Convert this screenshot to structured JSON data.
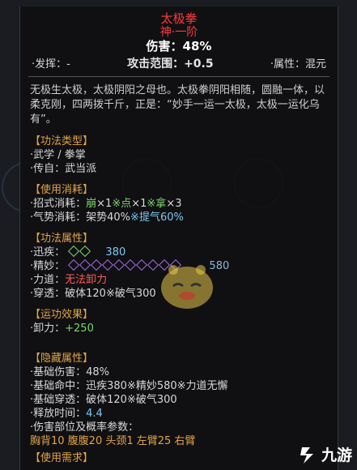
{
  "tooltip": {
    "name": "太极拳",
    "grade": "神·一阶",
    "damage": "伤害：48%",
    "windup": {
      "label": "·发挥：",
      "value": "-"
    },
    "range": {
      "label": "攻击范围：",
      "value": "+0.5"
    },
    "attribute": {
      "label": "·属性：",
      "value": "混元"
    },
    "description": "无极生太极，太极阴阳之母也。太极拳阴阳相随，圆融一体，以柔克刚，四两拨千斤，正是：“妙手一运一太极，太极一运化乌有”。"
  },
  "sections": {
    "type": {
      "header": "【功法类型】",
      "line1_label": "·武学 / 拳掌",
      "line2_label": "·传自：",
      "line2_value": "武当派"
    },
    "cost": {
      "header": "【使用消耗】",
      "moves_label": "·招式消耗：",
      "m1": "崩",
      "m1x": "×1",
      "m2": "※点",
      "m2x": "×1",
      "m3": "※拿",
      "m3x": "×3",
      "qi_label": "·气势消耗：",
      "qi_a": "架势40%",
      "qi_b": "※提气60%"
    },
    "props": {
      "header": "【功法属性】",
      "speed_label": "·迅疾：",
      "speed_value": "380",
      "skill_label": "·精妙：",
      "skill_value": "580",
      "force_label": "·力道：",
      "force_value": "无法卸力",
      "pierce_label": "·穿透：",
      "pierce_a": "破体120",
      "pierce_b": "※破气300"
    },
    "effect": {
      "header": "【运功效果】",
      "line_label": "·卸力：",
      "line_value": "+250"
    },
    "hidden": {
      "header": "【隐藏属性】",
      "l1_label": "·基础伤害：",
      "l1_value": "48%",
      "l2_label": "·基础命中：",
      "l2_value": "迅疾380※精妙580※力道无懈",
      "l3_label": "·基础穿透：",
      "l3_value": "破体120※破气300",
      "l4_label": "·释放时间：",
      "l4_value": "4.4",
      "l5_label": "·伤害部位及概率参数：",
      "l6_value": "胸背10 腹腹20 头颈1 左臂25 右臂"
    },
    "next_header": "【使用需求】"
  },
  "watermark": {
    "text": "九游"
  },
  "colors": {
    "title": "#ff3b3b",
    "header": "#e0a448",
    "green": "#7ed46a",
    "blue": "#7ec8f0"
  }
}
